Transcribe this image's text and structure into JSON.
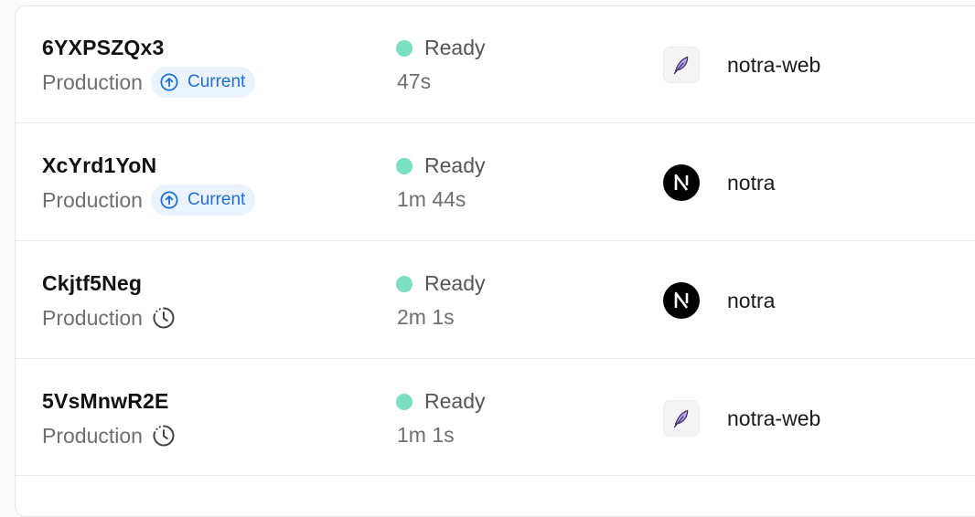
{
  "colors": {
    "ready_dot": "#79dfc0",
    "current_badge_bg": "#eaf2fd",
    "current_badge_text": "#1f6fd6"
  },
  "deployments": [
    {
      "id": "6YXPSZQx3",
      "environment": "Production",
      "current_label": "Current",
      "status": "Ready",
      "duration": "47s",
      "project_icon": "feather-icon",
      "project": "notra-web"
    },
    {
      "id": "XcYrd1YoN",
      "environment": "Production",
      "current_label": "Current",
      "status": "Ready",
      "duration": "1m 44s",
      "project_icon": "nextjs-icon",
      "project": "notra"
    },
    {
      "id": "Ckjtf5Neg",
      "environment": "Production",
      "status_icon": "clock-icon",
      "status": "Ready",
      "duration": "2m 1s",
      "project_icon": "nextjs-icon",
      "project": "notra"
    },
    {
      "id": "5VsMnwR2E",
      "environment": "Production",
      "status_icon": "clock-icon",
      "status": "Ready",
      "duration": "1m 1s",
      "project_icon": "feather-icon",
      "project": "notra-web"
    }
  ]
}
